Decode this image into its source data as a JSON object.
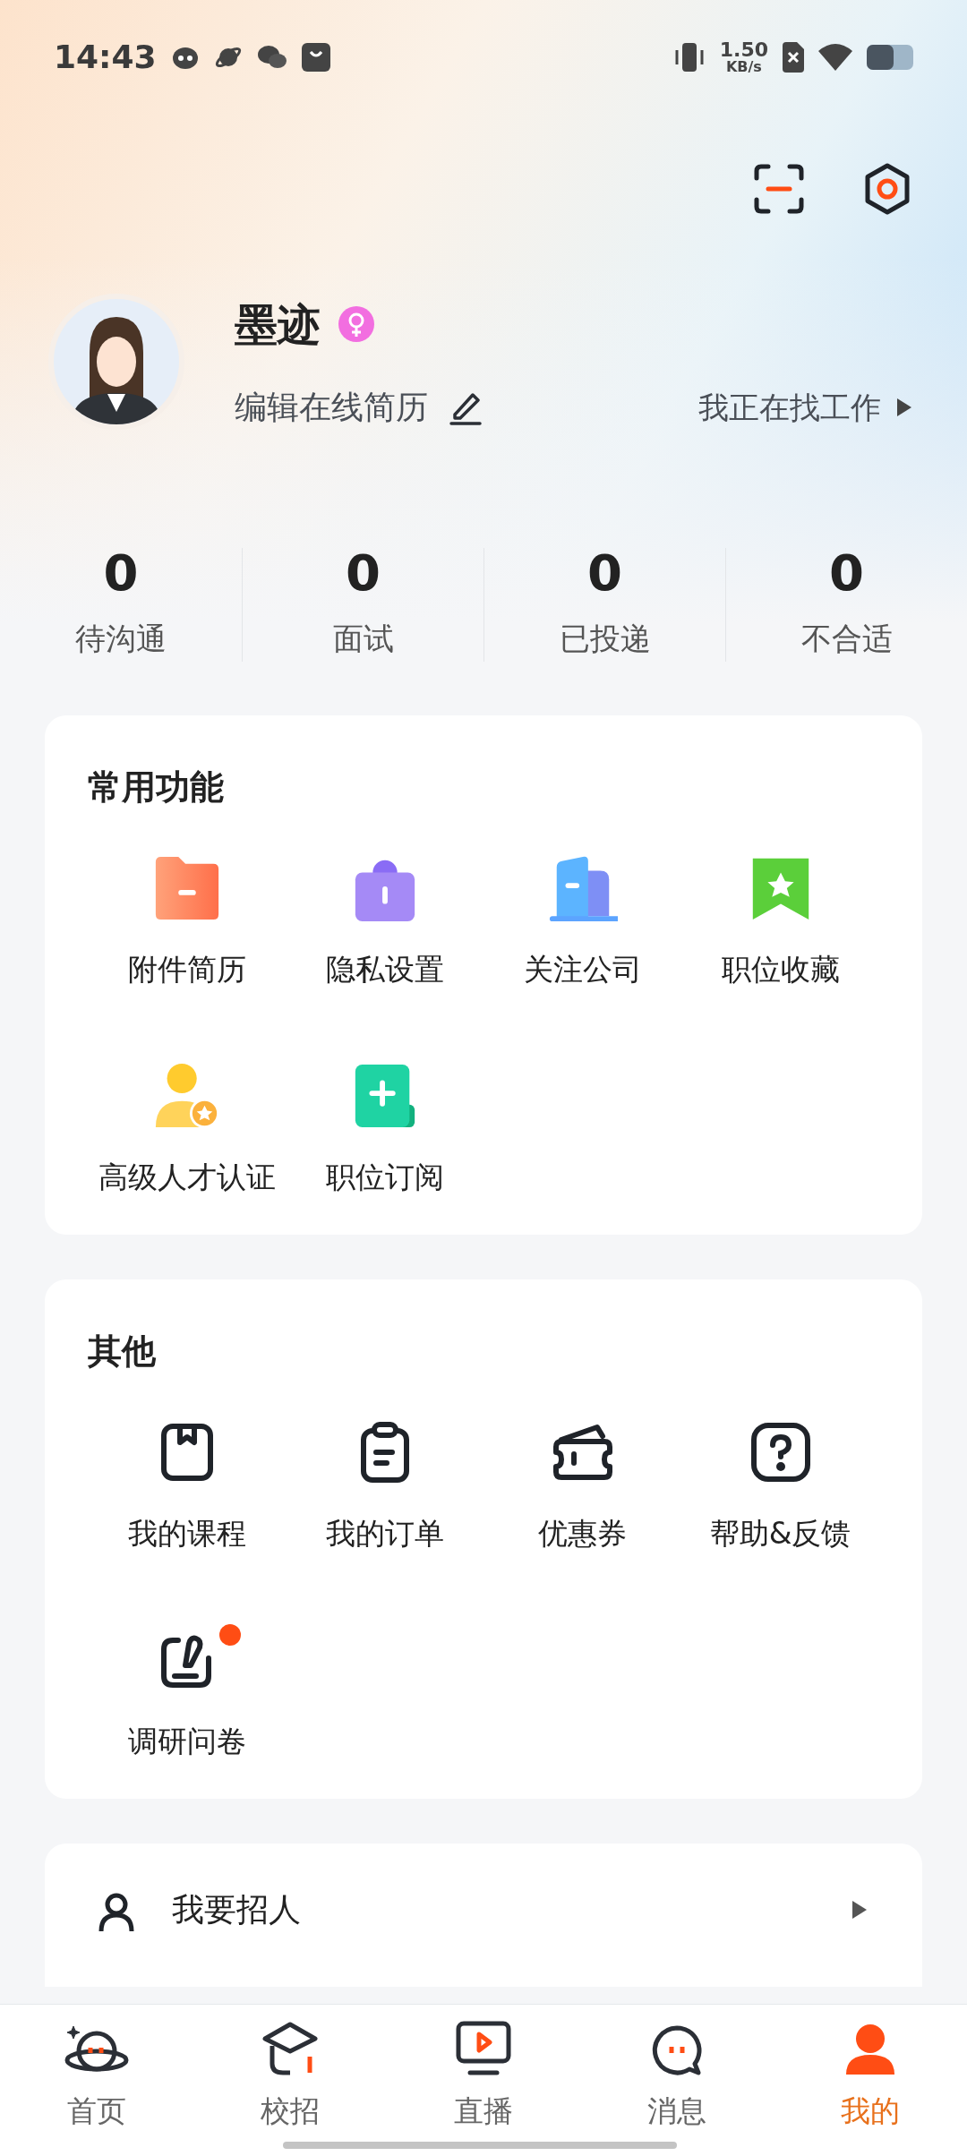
{
  "status_bar": {
    "time": "14:43",
    "speed": "1.50",
    "speed_unit": "KB/s"
  },
  "profile": {
    "name": "墨迹",
    "edit_label": "编辑在线简历",
    "job_status": "我正在找工作"
  },
  "stats": [
    {
      "value": "0",
      "label": "待沟通"
    },
    {
      "value": "0",
      "label": "面试"
    },
    {
      "value": "0",
      "label": "已投递"
    },
    {
      "value": "0",
      "label": "不合适"
    }
  ],
  "sections": [
    {
      "title": "常用功能",
      "items": [
        {
          "label": "附件简历",
          "badge": false
        },
        {
          "label": "隐私设置",
          "badge": false
        },
        {
          "label": "关注公司",
          "badge": false
        },
        {
          "label": "职位收藏",
          "badge": false
        },
        {
          "label": "高级人才认证",
          "badge": false
        },
        {
          "label": "职位订阅",
          "badge": false
        }
      ]
    },
    {
      "title": "其他",
      "items": [
        {
          "label": "我的课程",
          "badge": false
        },
        {
          "label": "我的订单",
          "badge": false
        },
        {
          "label": "优惠券",
          "badge": false
        },
        {
          "label": "帮助&反馈",
          "badge": false
        },
        {
          "label": "调研问卷",
          "badge": true
        }
      ]
    }
  ],
  "recruit": {
    "label": "我要招人"
  },
  "nav": [
    {
      "label": "首页",
      "selected": false
    },
    {
      "label": "校招",
      "selected": false
    },
    {
      "label": "直播",
      "selected": false
    },
    {
      "label": "消息",
      "selected": false
    },
    {
      "label": "我的",
      "selected": true
    }
  ]
}
